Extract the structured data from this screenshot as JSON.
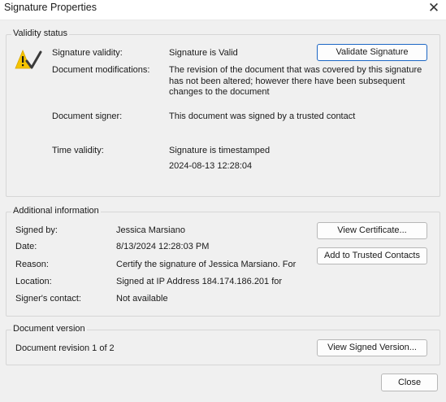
{
  "window": {
    "title": "Signature Properties",
    "close_glyph": "✕"
  },
  "validity": {
    "legend": "Validity status",
    "icon": "warning-check-icon",
    "rows": {
      "validity": {
        "label": "Signature validity:",
        "value": "Signature is Valid"
      },
      "modifications": {
        "label": "Document modifications:",
        "value": "The revision of the document that was covered by this signature has not been altered; however there have been subsequent changes to the document"
      },
      "signer": {
        "label": "Document signer:",
        "value": "This document was signed by a trusted contact"
      },
      "time": {
        "label": "Time validity:",
        "value": "Signature is timestamped",
        "timestamp": "2024-08-13 12:28:04"
      }
    },
    "validate_button": "Validate Signature"
  },
  "additional": {
    "legend": "Additional information",
    "rows": {
      "signed_by": {
        "label": "Signed by:",
        "value": "Jessica  Marsiano"
      },
      "date": {
        "label": "Date:",
        "value": "8/13/2024 12:28:03 PM"
      },
      "reason": {
        "label": "Reason:",
        "value": "Certify the signature of Jessica  Marsiano. For"
      },
      "location": {
        "label": "Location:",
        "value": "Signed at IP Address 184.174.186.201 for"
      },
      "contact": {
        "label": "Signer's contact:",
        "value": "Not available"
      }
    },
    "view_certificate_button": "View Certificate...",
    "add_trusted_button": "Add to Trusted Contacts"
  },
  "version": {
    "legend": "Document version",
    "revision": "Document revision 1 of 2",
    "view_signed_button": "View Signed Version..."
  },
  "close_button": "Close",
  "colors": {
    "warning_yellow": "#f5c400",
    "check_dark": "#3a3a3a",
    "focus_blue": "#1c66c4"
  }
}
